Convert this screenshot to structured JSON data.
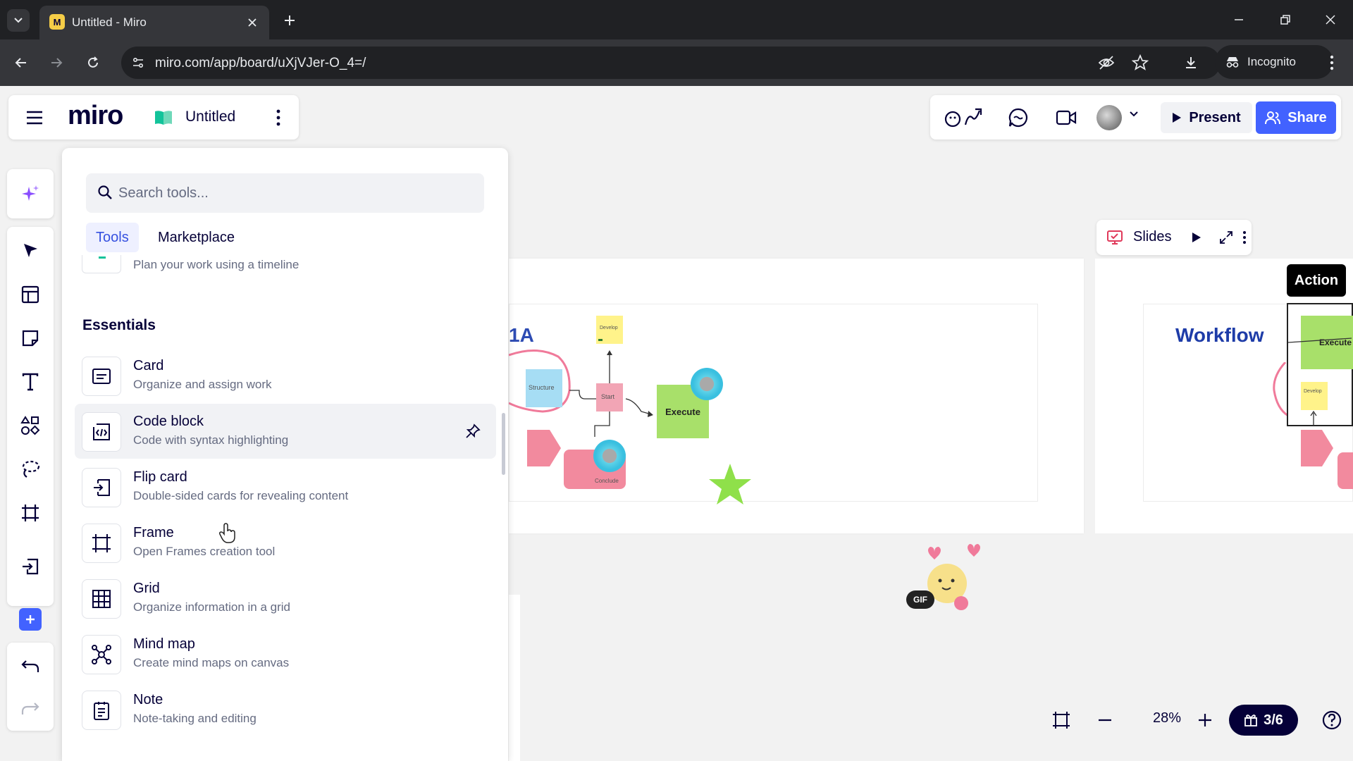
{
  "browser": {
    "tab_title": "Untitled - Miro",
    "favicon_letter": "M",
    "url": "miro.com/app/board/uXjVJer-O_4=/",
    "incognito_label": "Incognito"
  },
  "header": {
    "logo": "miro",
    "board_title": "Untitled"
  },
  "collab": {
    "present_label": "Present",
    "share_label": "Share",
    "reactions_icon": "reactions-icon",
    "comments_icon": "comments-icon",
    "video_icon": "video-icon"
  },
  "left_toolbar": {
    "items": [
      "ai-sparkle-icon",
      "select-icon",
      "templates-icon",
      "sticky-note-icon",
      "text-icon",
      "shapes-icon",
      "lasso-icon",
      "frame-icon",
      "upload-icon",
      "plus-icon",
      "undo-icon",
      "redo-icon"
    ]
  },
  "tools_panel": {
    "search_placeholder": "Search tools...",
    "tabs": [
      "Tools",
      "Marketplace"
    ],
    "timeline_desc": "Plan your work using a timeline",
    "section_title": "Essentials",
    "items": [
      {
        "title": "Card",
        "desc": "Organize and assign work",
        "icon": "card-icon"
      },
      {
        "title": "Code block",
        "desc": "Code with syntax highlighting",
        "icon": "code-block-icon"
      },
      {
        "title": "Flip card",
        "desc": "Double-sided cards for revealing content",
        "icon": "flip-card-icon"
      },
      {
        "title": "Frame",
        "desc": "Open Frames creation tool",
        "icon": "frame-icon"
      },
      {
        "title": "Grid",
        "desc": "Organize information in a grid",
        "icon": "grid-icon"
      },
      {
        "title": "Mind map",
        "desc": "Create mind maps on canvas",
        "icon": "mind-map-icon"
      },
      {
        "title": "Note",
        "desc": "Note-taking and editing",
        "icon": "note-icon"
      }
    ]
  },
  "canvas": {
    "frame1_heading": "1A",
    "frame2_heading": "Workflow",
    "sticky_structure": "Structure",
    "sticky_start": "Start",
    "sticky_execute": "Execute",
    "sticky_develop": "Develop",
    "sticky_conclude": "Conclude",
    "gif_badge": "GIF",
    "preview_execute": "Execute",
    "preview_develop": "Develop"
  },
  "slides_bar": {
    "label": "Slides"
  },
  "action_tag": "Action",
  "bottom_bar": {
    "zoom_level": "28%",
    "slide_counter": "3/6"
  },
  "colors": {
    "accent": "#4262ff",
    "miro_yellow": "#f5cd47",
    "ink": "#050038"
  }
}
